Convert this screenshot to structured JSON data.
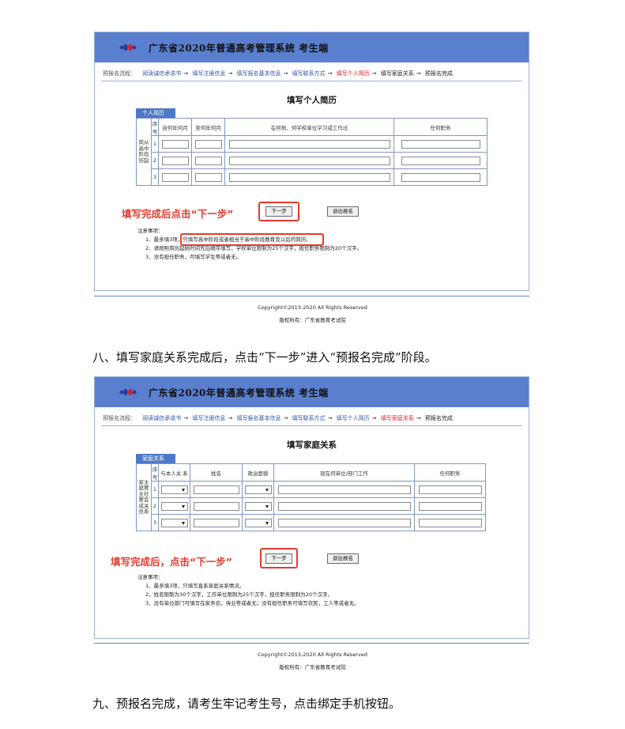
{
  "banner": {
    "title": "广东省2020年普通高考管理系统 考生端"
  },
  "flow": {
    "lead": "预报名流程：",
    "steps": [
      "阅读诚信承诺书",
      "填写注册信息",
      "填写报名基本信息",
      "填写联系方式",
      "填写个人简历",
      "填写家庭关系",
      "预报名完成"
    ],
    "arrow": "→"
  },
  "section1": {
    "title": "填写个人简历",
    "tab": "个人简历",
    "columns": [
      "序号",
      "自何年何月",
      "至何年何月",
      "在何地、何学校单位学习或工作过",
      "任何职务"
    ],
    "side_label": "简从高中阶段历起",
    "rows": [
      "1",
      "2",
      "3"
    ],
    "next_button": "下一步",
    "exit_button": "退出报名",
    "hint": "填写完成后点击“下一步”",
    "notes_title": "注意事项：",
    "notes": [
      "1、最多填3项，只填写高中阶段或者相当于高中阶段教育及以后的简历。",
      "2、请按照简历起始时间先后顺序填写，学校单位限制为25个汉字，担任职务限制为20个汉字。",
      "3、没有担任职务，可填写学生等或者无。"
    ]
  },
  "copyright": {
    "line1": "Copyright©2013-2020  All Rights Reserved",
    "line2": "版权所有：广东省教育考试院"
  },
  "para8": "八、填写家庭关系完成后，点击“下一步”进入“预报名完成”阶段。",
  "section2": {
    "title": "填写家庭关系",
    "tab": "家庭关系",
    "columns": [
      "序号",
      "与本人关 系",
      "姓名",
      "政治面貌",
      "现在何单位/部门工作",
      "任何职务"
    ],
    "side_label": "家主庭要主社要会成关员系",
    "rows": [
      "1",
      "2",
      "3"
    ],
    "next_button": "下一步",
    "exit_button": "退出报名",
    "hint": "填写完成后，点击“下一步”",
    "notes_title": "注意事项：",
    "notes": [
      "1、最多填3项，只填写直系家庭关系情况。",
      "2、姓名限制为30个汉字，工作单位限制为25个汉字，担任职务限制为20个汉字。",
      "3、没有单位部门可填写在家务农，待业等或者无；没有担任职务可填写农民，工人等或者无。"
    ]
  },
  "para9": "九、预报名完成，请考生牢记考生号，点击绑定手机按钮。",
  "colors": {
    "banner": "#5a7fcf",
    "tab": "#4c79c7",
    "highlight": "#e23b2e",
    "current_step": "#d81e1e"
  }
}
